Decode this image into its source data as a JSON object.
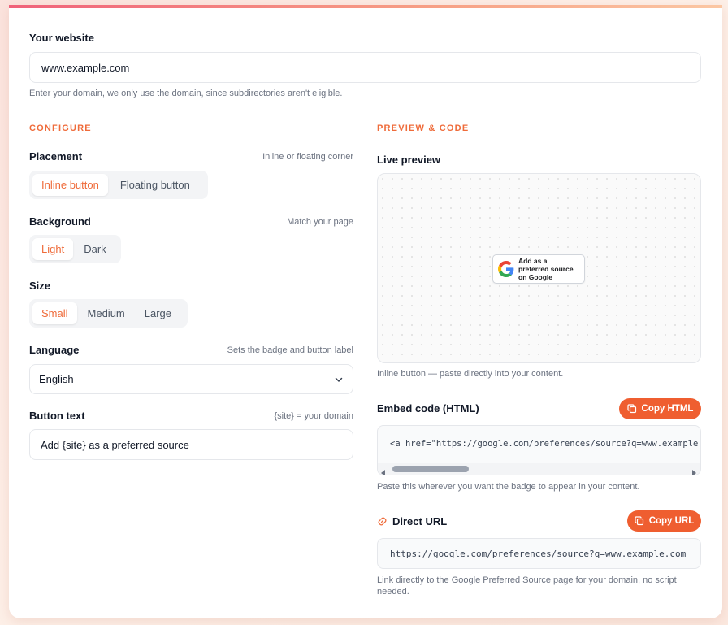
{
  "website": {
    "label": "Your website",
    "value": "www.example.com",
    "hint": "Enter your domain, we only use the domain, since subdirectories aren't eligible."
  },
  "configure": {
    "title": "CONFIGURE",
    "placement": {
      "label": "Placement",
      "hint": "Inline or floating corner",
      "options": [
        "Inline button",
        "Floating button"
      ],
      "selected": "Inline button"
    },
    "background": {
      "label": "Background",
      "hint": "Match your page",
      "options": [
        "Light",
        "Dark"
      ],
      "selected": "Light"
    },
    "size": {
      "label": "Size",
      "options": [
        "Small",
        "Medium",
        "Large"
      ],
      "selected": "Small"
    },
    "language": {
      "label": "Language",
      "hint": "Sets the badge and button label",
      "value": "English"
    },
    "button_text": {
      "label": "Button text",
      "hint": "{site} = your domain",
      "value": "Add {site} as a preferred source"
    }
  },
  "preview": {
    "title": "PREVIEW & CODE",
    "live_label": "Live preview",
    "badge_text": "Add as a preferred source on Google",
    "caption": "Inline button — paste directly into your content.",
    "embed": {
      "label": "Embed code (HTML)",
      "copy_label": "Copy HTML",
      "code": "<a href=\"https://google.com/preferences/source?q=www.example.com\" target=\"_blank\" rel=\"noopener\">",
      "hint": "Paste this wherever you want the badge to appear in your content."
    },
    "direct": {
      "label": "Direct URL",
      "copy_label": "Copy URL",
      "url": "https://google.com/preferences/source?q=www.example.com",
      "hint": "Link directly to the Google Preferred Source page for your domain, no script needed."
    }
  },
  "colors": {
    "accent": "#ef5e30",
    "accent_text": "#ef6b3a"
  }
}
